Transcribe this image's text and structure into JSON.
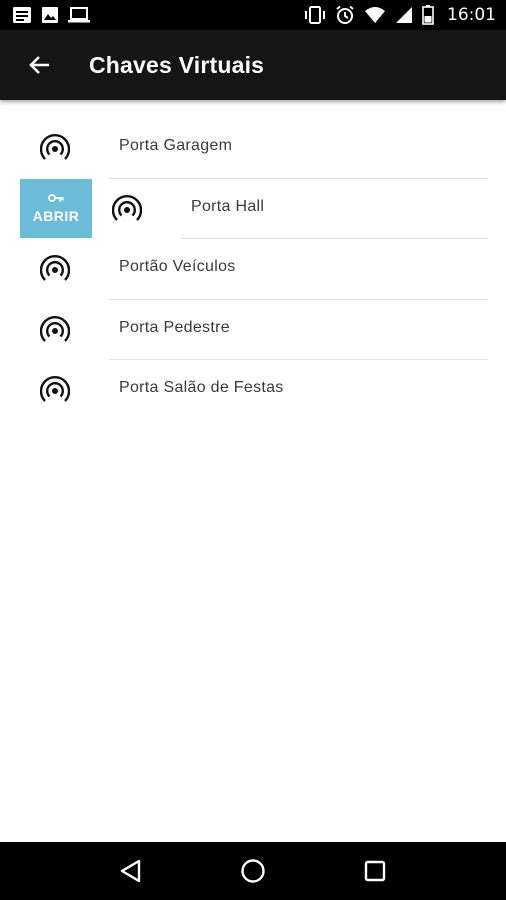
{
  "status_bar": {
    "time": "16:01",
    "left_icons": [
      "message-icon",
      "image-icon",
      "laptop-icon"
    ],
    "right_icons": [
      "vibrate-icon",
      "alarm-icon",
      "wifi-icon",
      "signal-icon",
      "battery-icon"
    ]
  },
  "app_bar": {
    "title": "Chaves Virtuais",
    "back_icon": "arrow-left-icon"
  },
  "doors": [
    {
      "label": "Porta Garagem",
      "icon": "rf-signal-icon"
    },
    {
      "label": "Porta Hall",
      "icon": "rf-signal-icon",
      "swiped": true
    },
    {
      "label": "Portão Veículos",
      "icon": "rf-signal-icon"
    },
    {
      "label": "Porta Pedestre",
      "icon": "rf-signal-icon"
    },
    {
      "label": "Porta Salão de Festas",
      "icon": "rf-signal-icon"
    }
  ],
  "swipe_action": {
    "label": "ABRIR",
    "icon": "key-icon",
    "color": "#6bbcd6"
  },
  "nav_bar": {
    "buttons": [
      "back-triangle-icon",
      "home-circle-icon",
      "recents-square-icon"
    ]
  },
  "colors": {
    "status_bar": "#000000",
    "app_bar": "#151515",
    "background": "#ffffff",
    "accent": "#6bbcd6"
  }
}
